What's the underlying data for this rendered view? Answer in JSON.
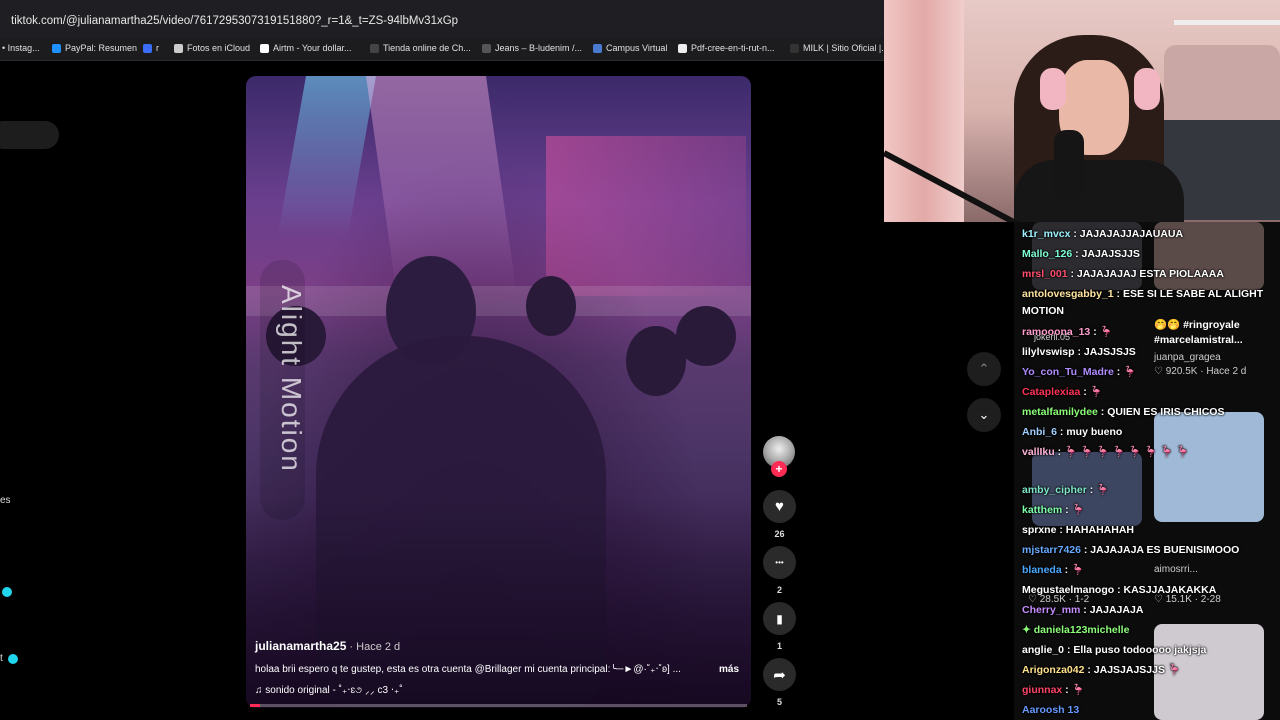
{
  "browser": {
    "url": "tiktok.com/@julianamartha25/video/7617295307319151880?_r=1&_t=ZS-94lbMv31xGp",
    "bookmarks": [
      {
        "label": "• Instag...",
        "icon_color": "#c13584"
      },
      {
        "label": "PayPal: Resumen",
        "icon_color": "#1e90ff"
      },
      {
        "label": "r",
        "icon_color": "#3b6cf6"
      },
      {
        "label": "Fotos en iCloud",
        "icon_color": "#cccccc"
      },
      {
        "label": "Airtm - Your dollar...",
        "icon_color": "#ffffff"
      },
      {
        "label": "Tienda online de Ch...",
        "icon_color": "#444444"
      },
      {
        "label": "Jeans – B-ludenim /...",
        "icon_color": "#555555"
      },
      {
        "label": "Campus Virtual",
        "icon_color": "#4a7bd0"
      },
      {
        "label": "Pdf-cree-en-ti-rut-n...",
        "icon_color": "#eeeeee"
      },
      {
        "label": "MILK | Sitio Oficial |...",
        "icon_color": "#333333"
      }
    ]
  },
  "left_panel": {
    "frag_1": "es",
    "frag_2": "t"
  },
  "video": {
    "overlay_text": "Alight Motion",
    "username": "julianamartha25",
    "time_ago": " · Hace 2 d",
    "description": "holaa brii espero q te gustep, esta es otra cuenta @Brillager mi cuenta principal:╰─►@·˚₊‧˚ʚ] ...",
    "more_label": "más",
    "sound": "♫  sonido original - ˚₊‧ɛ૭ ⸝⸝ ϲ3 ‧₊˚",
    "progress_fraction": 0.02
  },
  "actions": {
    "follow_symbol": "+",
    "like": {
      "icon": "heart-icon",
      "glyph": "♥",
      "count": "26"
    },
    "comment": {
      "icon": "comment-icon",
      "glyph": "•••",
      "count": "2"
    },
    "save": {
      "icon": "bookmark-icon",
      "glyph": "▮",
      "count": "1"
    },
    "share": {
      "icon": "share-icon",
      "glyph": "➦",
      "count": "5"
    }
  },
  "nav": {
    "up": "⌃",
    "down": "⌄"
  },
  "chat": {
    "messages": [
      {
        "user": "k1r_mvcx",
        "color": "#9ef2ff",
        "text": " : JAJAJAJJAJAUAUA"
      },
      {
        "user": "Mallo_126",
        "color": "#7fffd4",
        "text": " : JAJAJSJJS"
      },
      {
        "user": "mrsl_001",
        "color": "#ff4d6d",
        "text": " : JAJAJAJAJ ESTA PIOLAAAA"
      },
      {
        "user": "antolovesgabby_1",
        "color": "#ffe4a0",
        "text": " : ESE SI LE SABE AL ALIGHT MOTION"
      },
      {
        "user": "ramooona_13",
        "color": "#ff9ecd",
        "text": " : 🦩"
      },
      {
        "user": "lilylvswisp",
        "color": "#ffffff",
        "text": " : JAJSJSJS"
      },
      {
        "user": "Yo_con_Tu_Madre",
        "color": "#b18cff",
        "text": " : 🦩"
      },
      {
        "user": "Cataplexiaa",
        "color": "#ff3355",
        "text": " : 🦩"
      },
      {
        "user": "metalfamilydee",
        "color": "#8dff7a",
        "text": " : QUIEN ES IRIS CHICOS"
      },
      {
        "user": "Anbi_6",
        "color": "#9fd0ff",
        "text": " : muy bueno"
      },
      {
        "user": "vallIku",
        "color": "#ffb3d9",
        "text": " : 🦩 🦩 🦩 🦩 🦩 🦩 🦩 🦩"
      },
      {
        "user": "amby_cipher",
        "color": "#7ee8c8",
        "text": " : 🦩"
      },
      {
        "user": "katthem",
        "color": "#7fffaa",
        "text": " : 🦩"
      },
      {
        "user": "sprxne",
        "color": "#ffffff",
        "text": " : HAHAHAHAH"
      },
      {
        "user": "mjstarr7426",
        "color": "#66aaff",
        "text": " : JAJAJAJA ES BUENISIMOOO"
      },
      {
        "user": "blaneda",
        "color": "#4aa8ff",
        "text": " : 🦩"
      },
      {
        "user": "Megustaelmanogo",
        "color": "#ffffff",
        "text": " : KASJJAJAKAKKA"
      },
      {
        "user": "Cherry_mm",
        "color": "#c58cff",
        "text": " : JAJAJAJA"
      },
      {
        "user": "✦ daniela123michelle",
        "color": "#8dff7a",
        "text": ""
      },
      {
        "user": "anglie_0",
        "color": "#ffffff",
        "text": " : Ella puso todooooo jakjsja"
      },
      {
        "user": "Arigonza042",
        "color": "#ffe08a",
        "text": " : JAJSJAJSJJS 🦩"
      },
      {
        "user": "giunnax",
        "color": "#ff4466",
        "text": " : 🦩"
      },
      {
        "user": "Aaroosh 13",
        "color": "#6699ff",
        "text": ""
      }
    ],
    "ghost": {
      "g1": "🤭🤭 #ringroyale",
      "g2": "#marcelamistral...",
      "g3": "juanpa_gragea",
      "g4": "♡ 920.5K · Hace 2 d",
      "g5": "aimosrri...",
      "g6": "♡ 28.5K · 1-2",
      "g7": "♡ 15.1K · 2-28",
      "g8": "jokerli.05"
    }
  }
}
